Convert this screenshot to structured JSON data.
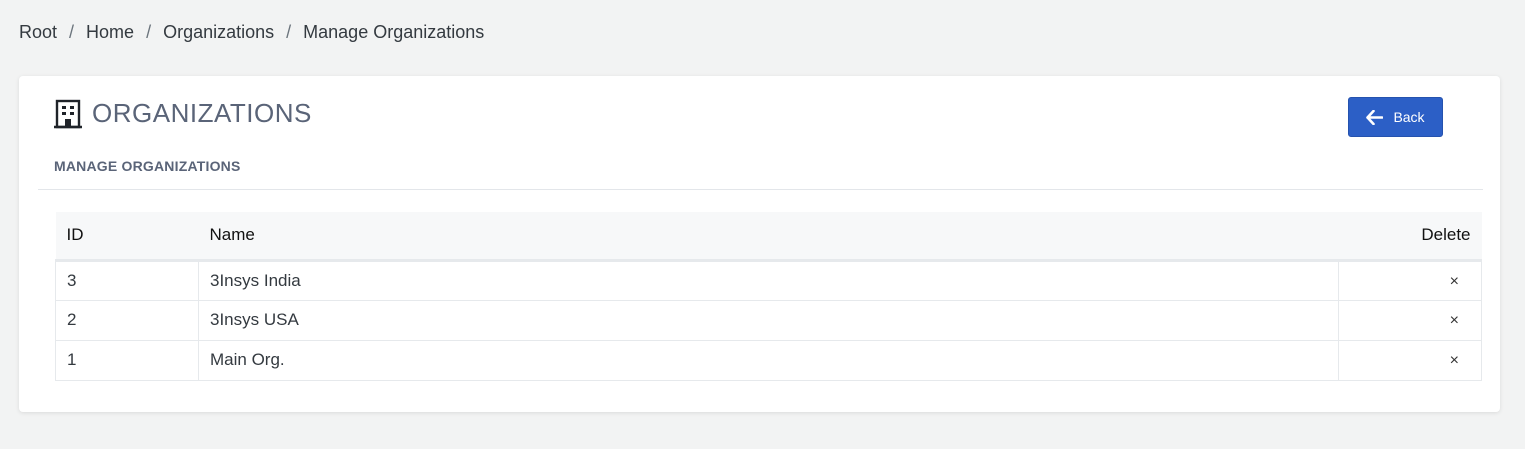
{
  "breadcrumb": {
    "items": [
      "Root",
      "Home",
      "Organizations",
      "Manage Organizations"
    ],
    "separator": "/"
  },
  "card": {
    "icon": "building-icon",
    "title": "ORGANIZATIONS",
    "subtitle": "MANAGE ORGANIZATIONS",
    "back_label": "Back"
  },
  "table": {
    "headers": {
      "id": "ID",
      "name": "Name",
      "delete": "Delete"
    },
    "rows": [
      {
        "id": "3",
        "name": "3Insys India",
        "delete": "×"
      },
      {
        "id": "2",
        "name": "3Insys USA",
        "delete": "×"
      },
      {
        "id": "1",
        "name": "Main Org.",
        "delete": "×"
      }
    ]
  },
  "colors": {
    "accent": "#2c5fc6",
    "title": "#5a6478",
    "background": "#f2f3f3"
  }
}
